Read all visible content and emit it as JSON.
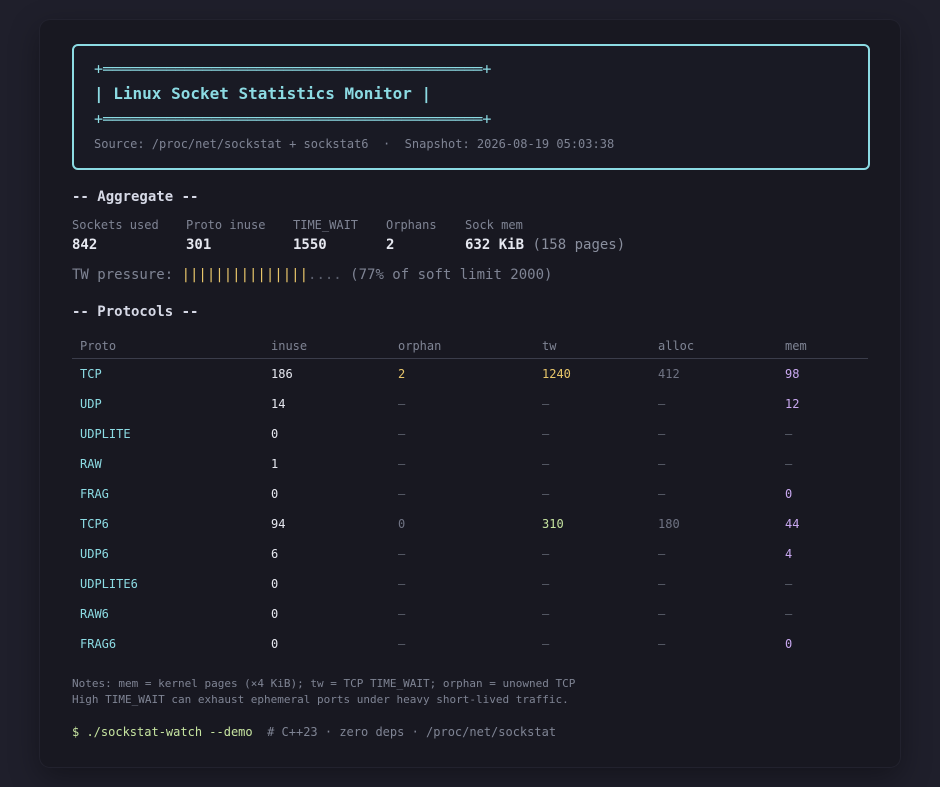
{
  "banner": {
    "line1": "+══════════════════════════════════════════+",
    "title": "| Linux Socket Statistics Monitor |",
    "line3": "+══════════════════════════════════════════+",
    "source": "Source: /proc/net/sockstat + sockstat6  ·  Snapshot: 2026-08-19 05:03:38"
  },
  "aggregate": {
    "heading": "-- Aggregate --",
    "items": [
      {
        "label": "Sockets used",
        "value": "842"
      },
      {
        "label": "Proto inuse",
        "value": "301"
      },
      {
        "label": "TIME_WAIT",
        "value": "1550"
      },
      {
        "label": "Orphans",
        "value": "2"
      },
      {
        "label": "Sock mem",
        "value": "632 KiB",
        "extra": "(158 pages)"
      }
    ]
  },
  "tw_pressure": {
    "label": "TW pressure: ",
    "bars": "|||||||||||||||",
    "dots": "....",
    "percent": 77,
    "text": " (77% of soft limit 2000)"
  },
  "protocols": {
    "heading": "-- Protocols --",
    "columns": [
      "Proto",
      "inuse",
      "orphan",
      "tw",
      "alloc",
      "mem"
    ],
    "rows": [
      [
        "TCP",
        "186",
        "2",
        "1240",
        "412",
        "98"
      ],
      [
        "UDP",
        "14",
        "–",
        "–",
        "–",
        "12"
      ],
      [
        "UDPLITE",
        "0",
        "–",
        "–",
        "–",
        "–"
      ],
      [
        "RAW",
        "1",
        "–",
        "–",
        "–",
        "–"
      ],
      [
        "FRAG",
        "0",
        "–",
        "–",
        "–",
        "0"
      ],
      [
        "TCP6",
        "94",
        "0",
        "310",
        "180",
        "44"
      ],
      [
        "UDP6",
        "6",
        "–",
        "–",
        "–",
        "4"
      ],
      [
        "UDPLITE6",
        "0",
        "–",
        "–",
        "–",
        "–"
      ],
      [
        "RAW6",
        "0",
        "–",
        "–",
        "–",
        "–"
      ],
      [
        "FRAG6",
        "0",
        "–",
        "–",
        "–",
        "0"
      ]
    ]
  },
  "notes": {
    "line1": "Notes: mem = kernel pages (×4 KiB); tw = TCP TIME_WAIT; orphan = unowned TCP",
    "line2": "High TIME_WAIT can exhaust ephemeral ports under heavy short-lived traffic."
  },
  "command": {
    "cmd": "$ ./sockstat-watch --demo",
    "comment": "  # C++23 · zero deps · /proc/net/sockstat"
  },
  "colors": {
    "accent": "#8cdbe3",
    "warn": "#e8c66a",
    "ok": "#c6e4a0",
    "mem": "#c9a8f0"
  }
}
